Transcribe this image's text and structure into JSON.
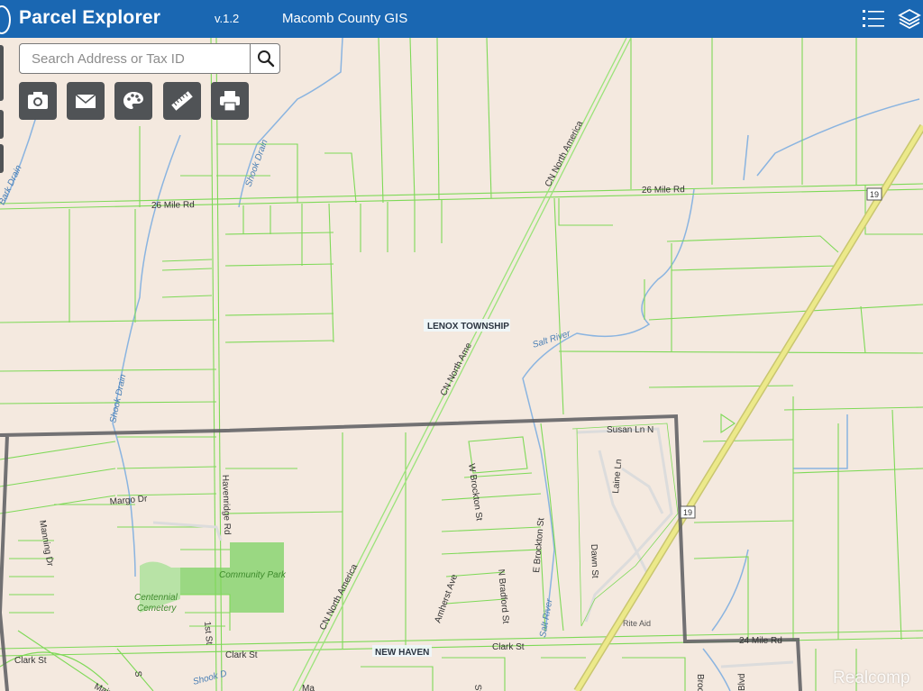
{
  "app": {
    "title": "Parcel Explorer",
    "version": "v.1.2",
    "organization": "Macomb County GIS",
    "header_color": "#1a67b2"
  },
  "header_icons": [
    "list-icon",
    "layers-icon"
  ],
  "search": {
    "placeholder": "Search Address or Tax ID",
    "value": ""
  },
  "toolbar": [
    "camera-icon",
    "mail-icon",
    "palette-icon",
    "ruler-icon",
    "print-icon"
  ],
  "map": {
    "background_color": "#f4e9df",
    "parcel_line_color": "#7ed957",
    "water_color": "#8ab4e0",
    "railroad_color": "#9be37a",
    "highway_color": "#ece98a",
    "township_boundary_color": "#5a5c60",
    "labels": {
      "road_26_mile_w": "26 Mile Rd",
      "road_26_mile_e": "26 Mile Rd",
      "route_19_n": "19",
      "route_19_s": "19",
      "township": "LENOX TOWNSHIP",
      "salt_river_n": "Salt River",
      "salt_river_s": "Salt River",
      "shook_drain_n": "Shook Drain",
      "shook_drain_s": "Shook Drain",
      "bark_drain": "Bark Drain",
      "rail_n": "CN North America",
      "rail_mid": "CN North Ame",
      "rail_s": "CN North America",
      "susan_ln": "Susan Ln N",
      "laine_ln": "Laine Ln",
      "w_brockton": "W Brockton St",
      "e_brockton": "E Brockton St",
      "n_bradford": "N Bradford St",
      "dawn_st": "Dawn St",
      "amherst": "Amherst Ave",
      "margo": "Margo Dr",
      "havenridge": "Havenridge Rd",
      "manning": "Manning Dr",
      "community_park": "Community Park",
      "cemetery_1": "Centennial",
      "cemetery_2": "Cemetery",
      "first_st": "1st St",
      "clark_st_w": "Clark St",
      "clark_st_mid": "Clark St",
      "clark_st_e": "Clark St",
      "new_haven": "NEW HAVEN",
      "rite_aid": "Rite Aid",
      "mile_rd_se": "24 Mile Rd",
      "shook_s": "Shook D",
      "broo": "Broo",
      "blvd": "Blvd",
      "main": "Main",
      "s_st": "S",
      "ma": "Ma",
      "st_frag": "St"
    }
  },
  "watermark": "Realcomp"
}
